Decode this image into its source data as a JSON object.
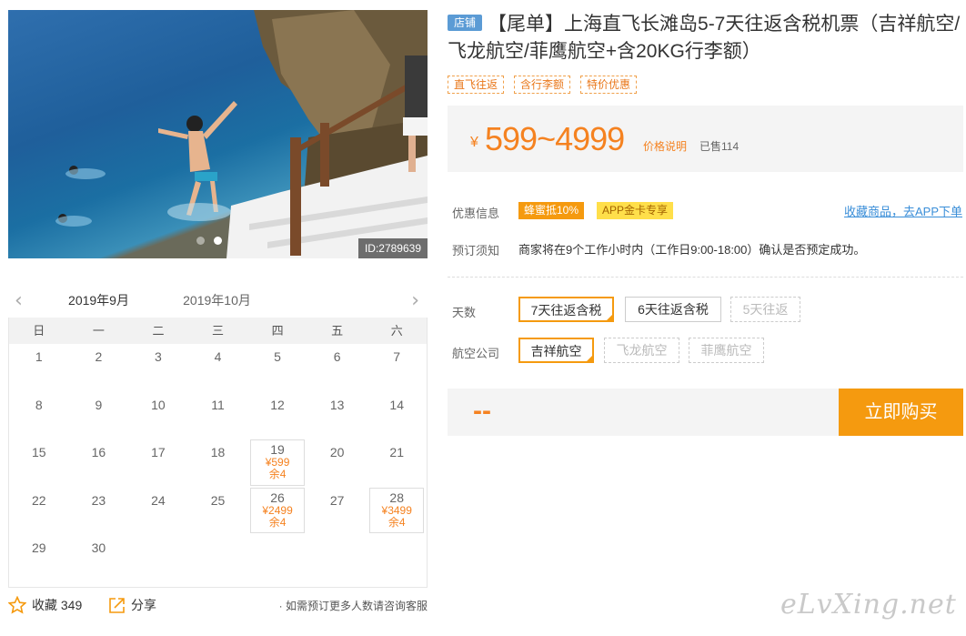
{
  "photo": {
    "id_label": "ID:2789639"
  },
  "calendar": {
    "prev_arrow": "‹",
    "next_arrow": "›",
    "month_active": "2019年9月",
    "month_next": "2019年10月",
    "weekdays": [
      "日",
      "一",
      "二",
      "三",
      "四",
      "五",
      "六"
    ],
    "days": [
      {
        "d": "1"
      },
      {
        "d": "2"
      },
      {
        "d": "3"
      },
      {
        "d": "4"
      },
      {
        "d": "5"
      },
      {
        "d": "6"
      },
      {
        "d": "7"
      },
      {
        "d": "8"
      },
      {
        "d": "9"
      },
      {
        "d": "10"
      },
      {
        "d": "11"
      },
      {
        "d": "12"
      },
      {
        "d": "13"
      },
      {
        "d": "14"
      },
      {
        "d": "15"
      },
      {
        "d": "16"
      },
      {
        "d": "17"
      },
      {
        "d": "18"
      },
      {
        "d": "19",
        "price": "¥599",
        "stock": "余4"
      },
      {
        "d": "20"
      },
      {
        "d": "21"
      },
      {
        "d": "22"
      },
      {
        "d": "23"
      },
      {
        "d": "24"
      },
      {
        "d": "25"
      },
      {
        "d": "26",
        "price": "¥2499",
        "stock": "余4"
      },
      {
        "d": "27"
      },
      {
        "d": "28",
        "price": "¥3499",
        "stock": "余4"
      },
      {
        "d": "29"
      },
      {
        "d": "30"
      }
    ]
  },
  "footer": {
    "fav_label": "收藏 349",
    "share_label": "分享",
    "note": "· 如需预订更多人数请咨询客服"
  },
  "product": {
    "shop_badge": "店铺",
    "title": "【尾单】上海直飞长滩岛5-7天往返含税机票（吉祥航空/飞龙航空/菲鹰航空+含20KG行李额）",
    "tags": [
      "直飞往返",
      "含行李额",
      "特价优惠"
    ],
    "currency": "¥",
    "price_range": "599~4999",
    "price_desc": "价格说明",
    "sold": "已售114"
  },
  "promo": {
    "label": "优惠信息",
    "coupon1": "蜂蜜抵10%",
    "coupon2": "APP金卡专享",
    "app_link": "收藏商品，去APP下单"
  },
  "booking": {
    "label": "预订须知",
    "text": "商家将在9个工作小时内（工作日9:00-18:00）确认是否预定成功。"
  },
  "options": {
    "days_label": "天数",
    "days": [
      "7天往返含税",
      "6天往返含税",
      "5天往返"
    ],
    "airline_label": "航空公司",
    "airlines": [
      "吉祥航空",
      "飞龙航空",
      "菲鹰航空"
    ]
  },
  "buy": {
    "price_placeholder": "--",
    "button": "立即购买"
  },
  "watermark": "eLvXing.net",
  "colors": {
    "accent": "#f59a0f",
    "price": "#f58220",
    "link": "#3a8ed8",
    "shop_badge": "#5b9bd5"
  }
}
